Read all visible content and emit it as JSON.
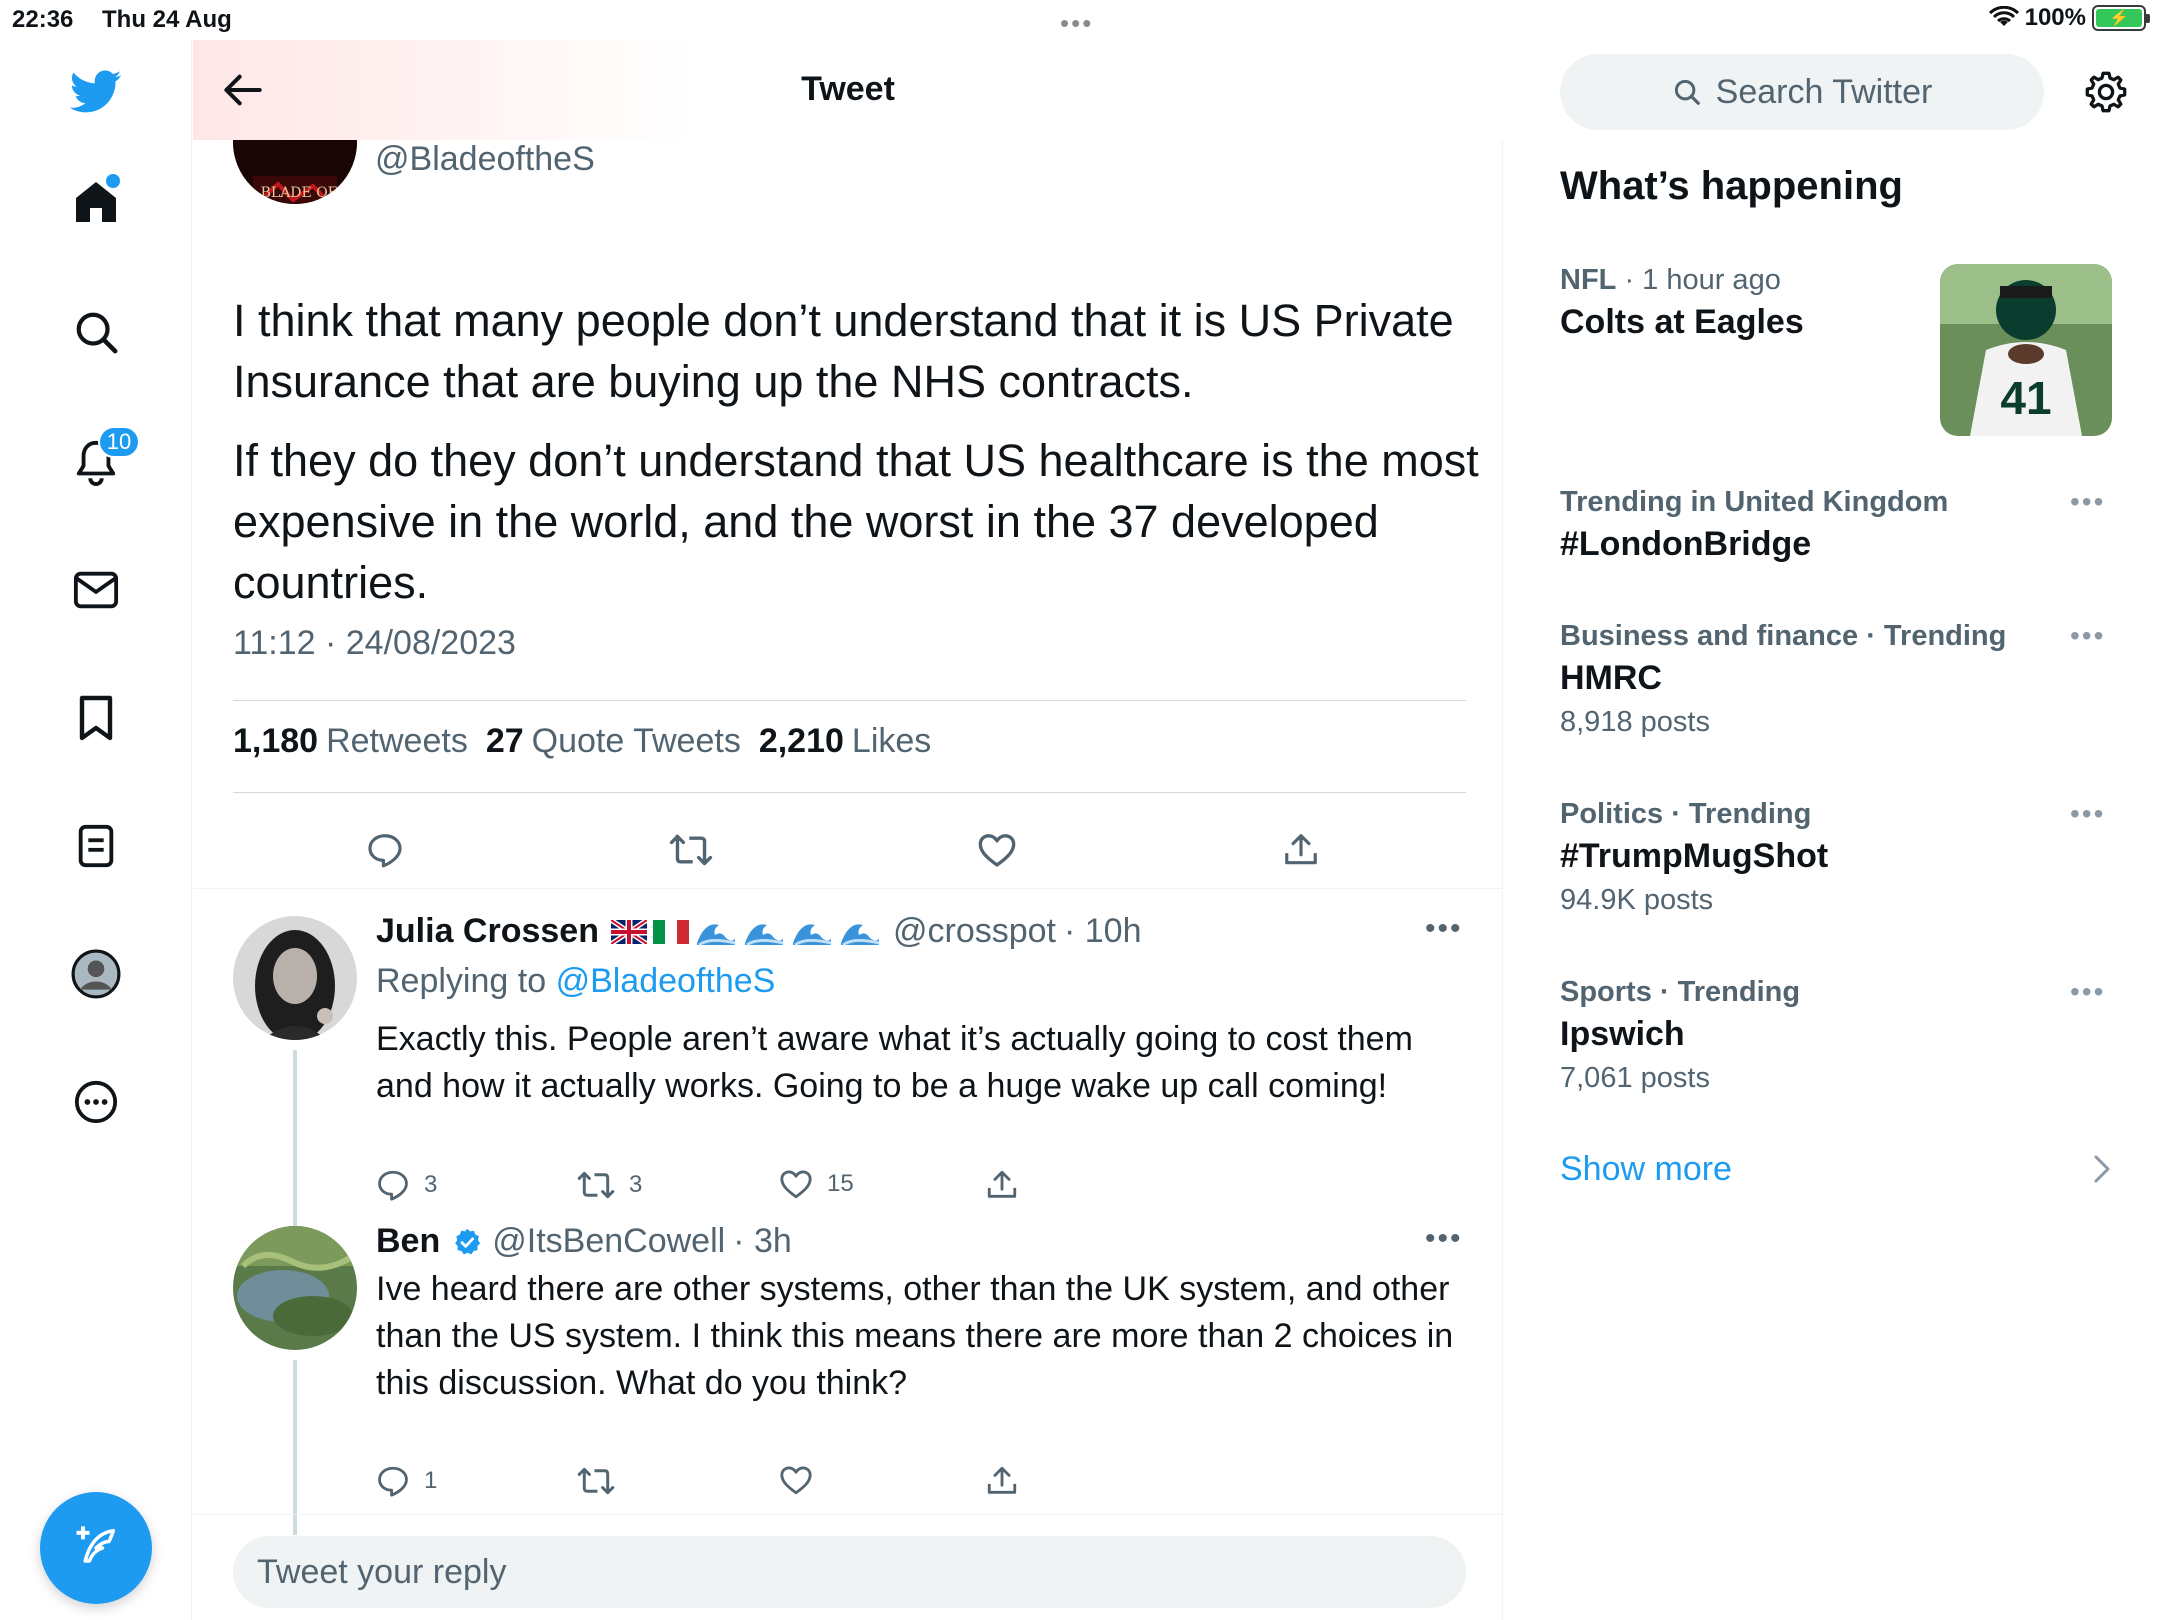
{
  "status_bar": {
    "time": "22:36",
    "date": "Thu 24 Aug",
    "battery": "100%"
  },
  "nav": {
    "notification_count": "10",
    "items": [
      "twitter-logo",
      "home",
      "explore",
      "notifications",
      "messages",
      "bookmarks",
      "lists",
      "profile",
      "more"
    ]
  },
  "header": {
    "title": "Tweet"
  },
  "tweet": {
    "handle": "@BladeoftheS",
    "avatar_text": "BLADE OF THE",
    "paragraphs": [
      "I think that many people don’t understand that it is US Private Insurance that are buying up the NHS contracts.",
      "If they do they don’t understand that US healthcare is the most expensive in the world, and the worst in the 37 developed countries."
    ],
    "timestamp": "11:12 · 24/08/2023",
    "retweets_count": "1,180",
    "retweets_label": "Retweets",
    "quotes_count": "27",
    "quotes_label": "Quote Tweets",
    "likes_count": "2,210",
    "likes_label": "Likes"
  },
  "replies": [
    {
      "name": "Julia Crossen",
      "handle": "@crosspot",
      "time": "· 10h",
      "replying_prefix": "Replying to",
      "replying_handle": "@BladeoftheS",
      "text": "Exactly this. People aren’t aware what it’s actually going to cost them and how it actually works. Going to be a huge wake up call coming!",
      "reply_count": "3",
      "retweet_count": "3",
      "like_count": "15"
    },
    {
      "name": "Ben",
      "handle": "@ItsBenCowell",
      "time": "· 3h",
      "text": "Ive heard there are other systems, other than the UK system, and other than the US system. I think this means there are more than 2 choices in this discussion. What do you think?",
      "reply_count": "1",
      "retweet_count": "",
      "like_count": ""
    }
  ],
  "reply_box": {
    "placeholder": "Tweet your reply"
  },
  "sidebar": {
    "search_placeholder": "Search Twitter",
    "section_title": "What’s happening",
    "trends": [
      {
        "category": "NFL",
        "meta": "· 1 hour ago",
        "name": "Colts at Eagles",
        "count": ""
      },
      {
        "category": "Trending in United Kingdom",
        "meta": "",
        "name": "#LondonBridge",
        "count": ""
      },
      {
        "category": "Business and finance · Trending",
        "meta": "",
        "name": "HMRC",
        "count": "8,918 posts"
      },
      {
        "category": "Politics · Trending",
        "meta": "",
        "name": "#TrumpMugShot",
        "count": "94.9K posts"
      },
      {
        "category": "Sports · Trending",
        "meta": "",
        "name": "Ipswich",
        "count": "7,061 posts"
      }
    ],
    "show_more": "Show more"
  },
  "colors": {
    "accent": "#1d9bf0",
    "text_primary": "#0f1419",
    "text_secondary": "#536471",
    "divider": "#eff3f4"
  }
}
